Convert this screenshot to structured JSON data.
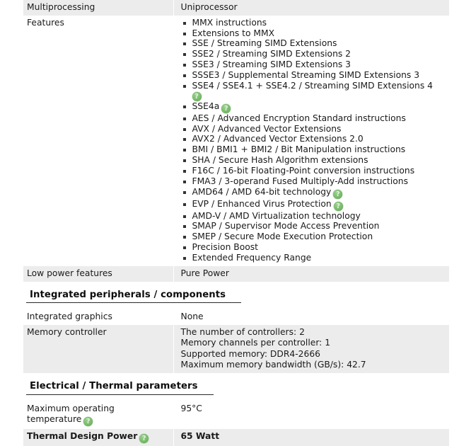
{
  "page": {
    "title": "CPU specification table",
    "accent_green": "#76b969",
    "row_shade": "#ececec",
    "text_color": "#1a1a1a"
  },
  "icons": {
    "help": "?",
    "help_name": "help-question-icon",
    "bullet": "square-bullet"
  },
  "rows": {
    "multiprocessing": {
      "label": "Multiprocessing",
      "value": "Uniprocessor"
    },
    "features": {
      "label": "Features",
      "items": [
        "MMX instructions",
        "Extensions to MMX",
        "SSE / Streaming SIMD Extensions",
        "SSE2 / Streaming SIMD Extensions 2",
        "SSE3 / Streaming SIMD Extensions 3",
        "SSSE3 / Supplemental Streaming SIMD Extensions 3",
        "SSE4 / SSE4.1 + SSE4.2 / Streaming SIMD Extensions 4",
        "SSE4a",
        "AES / Advanced Encryption Standard instructions",
        "AVX / Advanced Vector Extensions",
        "AVX2 / Advanced Vector Extensions 2.0",
        "BMI / BMI1 + BMI2 / Bit Manipulation instructions",
        "SHA / Secure Hash Algorithm extensions",
        "F16C / 16-bit Floating-Point conversion instructions",
        "FMA3 / 3-operand Fused Multiply-Add instructions",
        "AMD64 / AMD 64-bit technology",
        "EVP / Enhanced Virus Protection",
        "AMD-V / AMD Virtualization technology",
        "SMAP / Supervisor Mode Access Prevention",
        "SMEP / Secure Mode Execution Protection",
        "Precision Boost",
        "Extended Frequency Range"
      ]
    },
    "low_power": {
      "label": "Low power features",
      "value": "Pure Power"
    },
    "integrated_graphics": {
      "label": "Integrated graphics",
      "value": "None"
    },
    "memory_controller": {
      "label": "Memory controller",
      "lines": [
        "The number of controllers: 2",
        "Memory channels per controller: 1",
        "Supported memory: DDR4-2666",
        "Maximum memory bandwidth (GB/s): 42.7"
      ]
    },
    "max_temp": {
      "label_line1": "Maximum operating",
      "label_line2": "temperature",
      "value": "95°C"
    },
    "tdp": {
      "label": "Thermal Design Power",
      "value": "65 Watt"
    }
  },
  "sections": {
    "integrated": "Integrated peripherals / components",
    "electrical": "Electrical / Thermal parameters"
  }
}
